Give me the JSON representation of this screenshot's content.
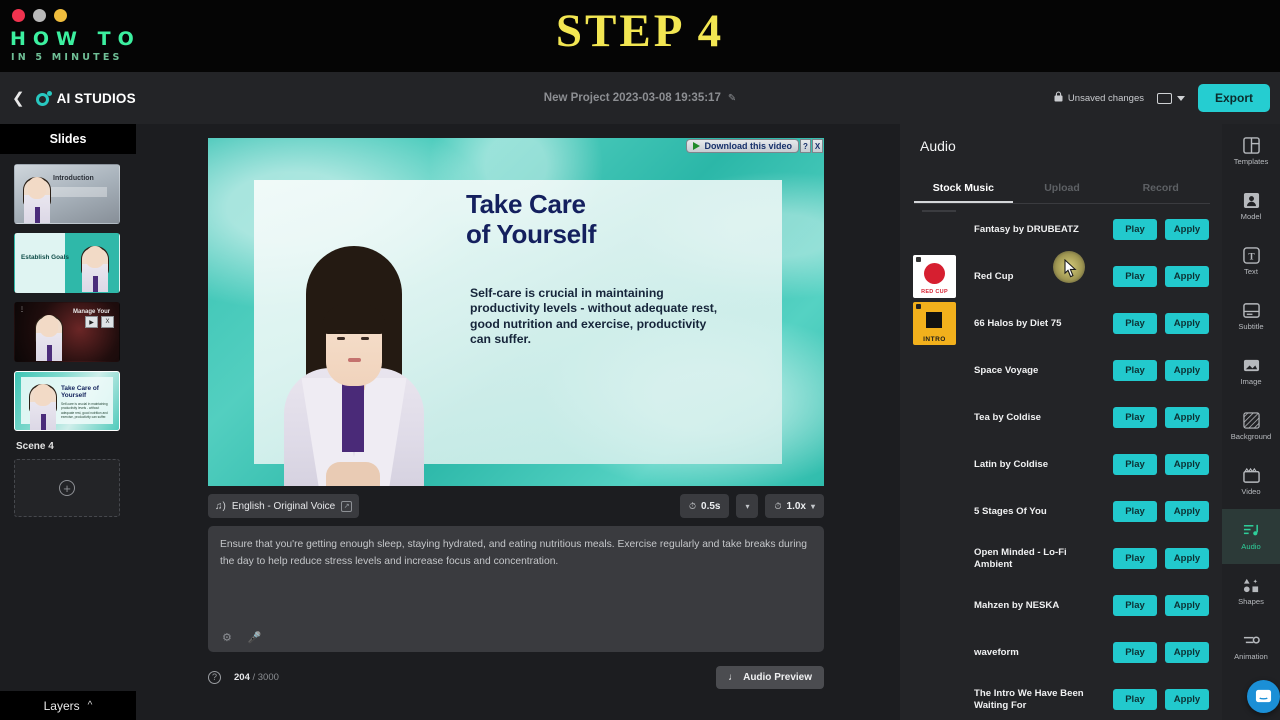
{
  "video_banner": {
    "title": "HOW TO",
    "subtitle": "IN 5 MINUTES",
    "step_label": "STEP 4",
    "step_color": "#f2e652",
    "title_color": "#3cf0a0",
    "window_dots": [
      "close-dot",
      "minimize-dot",
      "maximize-dot"
    ]
  },
  "header": {
    "back_icon": "chevron-left-icon",
    "brand": "AI STUDIOS",
    "brand_color": "#28c8c0",
    "project_title": "New Project 2023-03-08 19:35:17",
    "project_edit_icon": "pencil-edit-icon",
    "save_state": "Unsaved changes",
    "save_state_icon": "lock-icon",
    "screen_ratio_icon": "screen-ratio-icon",
    "export_label": "Export",
    "export_color": "#25cdd1"
  },
  "slides_panel": {
    "heading": "Slides",
    "scene_label": "Scene 4",
    "add_slide_icon": "plus-circle-icon",
    "layers_label": "Layers",
    "layers_chevron": "chevron-up-icon",
    "thumbnails": [
      {
        "label": "Introduction",
        "selected": false
      },
      {
        "label": "Establish Goals",
        "selected": false
      },
      {
        "label": "Manage Your",
        "selected": false
      },
      {
        "label": "Take Care of Yourself",
        "selected": true
      }
    ],
    "thumb3_overlay": {
      "play": "▶",
      "close": "X"
    }
  },
  "canvas": {
    "slide_title_line1": "Take Care",
    "slide_title_line2": "of Yourself",
    "slide_title_color": "#14205e",
    "slide_body": "Self-care is crucial in maintaining productivity levels - without adequate rest, good nutrition and exercise, productivity can suffer.",
    "recorder_overlay": {
      "label": "Download this video",
      "help_label": "?",
      "close_label": "X",
      "play_icon": "play-triangle-icon"
    }
  },
  "voice_toolbar": {
    "voice_icon": "voice-wave-icon",
    "voice_label": "English - Original Voice",
    "voice_badge_icon": "external-link-icon",
    "pause_icon": "clock-icon",
    "pause_value": "0.5s",
    "pause_chevron": "chevron-down-icon",
    "speed_icon": "speedometer-icon",
    "speed_value": "1.0x",
    "speed_chevron": "chevron-down-icon"
  },
  "script": {
    "text": "Ensure that you're getting enough sleep, staying hydrated, and eating nutritious meals. Exercise regularly and take breaks during the day to help reduce stress levels and increase focus and concentration.",
    "settings_icon": "gear-icon",
    "mic_icon": "microphone-icon",
    "help_icon": "question-circle-icon",
    "char_count": "204",
    "char_limit": "/ 3000",
    "audio_preview_label": "Audio Preview",
    "audio_preview_icon": "ear-icon"
  },
  "audio_panel": {
    "heading": "Audio",
    "tabs": [
      {
        "label": "Stock Music",
        "active": true
      },
      {
        "label": "Upload",
        "active": false
      },
      {
        "label": "Record",
        "active": false
      }
    ],
    "play_label": "Play",
    "apply_label": "Apply",
    "button_color": "#22c9cd",
    "tracks": [
      {
        "name": "Fantasy by DRUBEATZ",
        "art": "none"
      },
      {
        "name": "Red Cup",
        "art": "redcup",
        "art_caption": "RED CUP"
      },
      {
        "name": "66 Halos by Diet 75",
        "art": "halos",
        "art_caption": "INTRO"
      },
      {
        "name": "Space Voyage",
        "art": "none"
      },
      {
        "name": "Tea by Coldise",
        "art": "none"
      },
      {
        "name": "Latin by Coldise",
        "art": "none"
      },
      {
        "name": "5 Stages Of You",
        "art": "none"
      },
      {
        "name": "Open Minded - Lo-Fi Ambient",
        "art": "none"
      },
      {
        "name": "Mahzen by NESKA",
        "art": "none"
      },
      {
        "name": "waveform",
        "art": "none"
      },
      {
        "name": "The Intro We Have Been Waiting For",
        "art": "none"
      }
    ]
  },
  "tool_rail": {
    "active_color": "#2ecf9a",
    "items": [
      {
        "label": "Templates",
        "icon": "templates-icon",
        "active": false
      },
      {
        "label": "Model",
        "icon": "model-person-icon",
        "active": false
      },
      {
        "label": "Text",
        "icon": "text-t-icon",
        "active": false
      },
      {
        "label": "Subtitle",
        "icon": "subtitle-icon",
        "active": false
      },
      {
        "label": "Image",
        "icon": "image-icon",
        "active": false
      },
      {
        "label": "Background",
        "icon": "background-hatch-icon",
        "active": false
      },
      {
        "label": "Video",
        "icon": "video-clapper-icon",
        "active": false
      },
      {
        "label": "Audio",
        "icon": "audio-note-icon",
        "active": true
      },
      {
        "label": "Shapes",
        "icon": "shapes-icon",
        "active": false
      },
      {
        "label": "Animation",
        "icon": "animation-icon",
        "active": false
      }
    ],
    "chat_icon": "intercom-chat-icon",
    "chat_color": "#1b8fd6"
  },
  "cursor": {
    "icon": "mouse-pointer-icon",
    "click_highlight_color": "#e2d880"
  }
}
